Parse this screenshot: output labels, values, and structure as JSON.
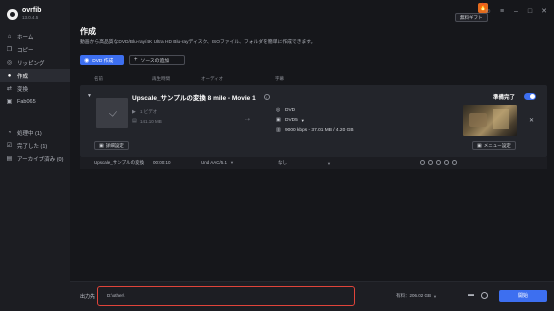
{
  "app": {
    "name": "ovrfib",
    "version": "13.0.4.5"
  },
  "sidebar": {
    "items": [
      {
        "label": "ホーム",
        "icon": "home-icon",
        "glyph": "⌂"
      },
      {
        "label": "コピー",
        "icon": "copy-icon",
        "glyph": "❐"
      },
      {
        "label": "リッピング",
        "icon": "rip-icon",
        "glyph": "◎"
      },
      {
        "label": "作成",
        "icon": "create-icon",
        "glyph": "●"
      },
      {
        "label": "変換",
        "icon": "convert-icon",
        "glyph": "⇄"
      },
      {
        "label": "Fab065",
        "icon": "fab-icon",
        "glyph": "▣"
      }
    ],
    "active_index": 3,
    "status_items": [
      {
        "label": "処理中 (1)",
        "icon": "processing-icon",
        "glyph": "◔"
      },
      {
        "label": "完了した (1)",
        "icon": "done-icon",
        "glyph": "☑"
      },
      {
        "label": "アーカイブ済み (0)",
        "icon": "archive-icon",
        "glyph": "▤"
      }
    ]
  },
  "topbar": {
    "free_gift": "無料ギフト",
    "fire": "🔥"
  },
  "page": {
    "title": "作成",
    "description": "動画から高品質なDVD/Blu-ray/4K Ultra HD Blu-rayディスク、ISOファイル、フォルダを簡単に作成できます。"
  },
  "toolbar": {
    "dvd_create": "DVD 作成",
    "add_source": "ソースの追加"
  },
  "columns": {
    "name": "名前",
    "duration": "再生時間",
    "audio": "オーディオ",
    "subtitle": "字幕"
  },
  "item": {
    "title": "Upscale_サンプルの変換 8 mile - Movie 1",
    "chapters": "1 ビデオ",
    "duration": "141.10 MB",
    "output_format": "DVD",
    "output_type": "DVD5",
    "bitrate": "9000 kbps - 37.01 MB / 4.20 GB",
    "detail_button": "詳細設定",
    "status": "準備完了",
    "menu_button": "メニュー設定"
  },
  "subrow": {
    "name": "Upscale_サンプルの変換",
    "time": "00:00:10",
    "audio": "Und AAC/5.1",
    "subtitle": "なし"
  },
  "bottom": {
    "output_label": "出力先",
    "output_path": "D:\\other\\",
    "size": "有料：206.02 GB",
    "start": "開始"
  },
  "colors": {
    "accent": "#3d6ff0",
    "highlight": "#e0443a",
    "bg": "#16171b"
  }
}
